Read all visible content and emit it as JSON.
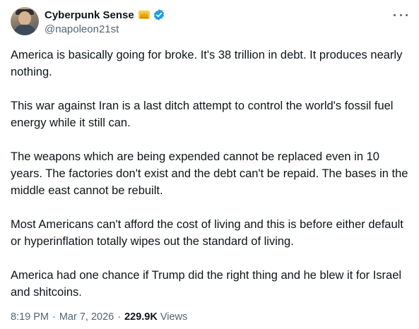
{
  "author": {
    "display_name": "Cyberpunk Sense",
    "handle": "@napoleon21st"
  },
  "icons": {
    "avatar": "profile-photo",
    "badge_crown": "crown-icon",
    "badge_verified": "verified-badge-icon",
    "more": "more-options-icon"
  },
  "colors": {
    "verified": "#1d9bf0",
    "crown": "#f4b400",
    "muted_text": "#536471"
  },
  "paragraphs": [
    "America is basically going for broke. It's 38 trillion in debt. It produces nearly nothing.",
    "This war against Iran is a last ditch attempt to control the world's fossil fuel energy while it still can.",
    "The weapons which are being expended cannot be replaced even in 10 years. The factories don't exist and the debt can't be repaid. The bases in the middle east cannot be rebuilt.",
    "Most Americans can't afford the cost of living and this is before either default or hyperinflation totally wipes out the standard of living.",
    "America had one chance if Trump did the right thing and he blew it for Israel and shitcoins."
  ],
  "meta": {
    "time": "8:19 PM",
    "separator": "·",
    "date": "Mar 7, 2026",
    "views_count": "229.9K",
    "views_label": "Views"
  }
}
